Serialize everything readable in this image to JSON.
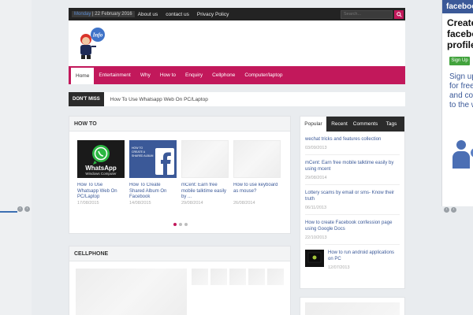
{
  "topbar": {
    "day": "Monday",
    "date": "22 February 2016",
    "links": [
      "About us",
      "contact us",
      "Privacy Policy"
    ],
    "search_placeholder": "Search..."
  },
  "menu": {
    "items": [
      "Home",
      "Entertainment",
      "Why",
      "How to",
      "Enquiry",
      "Cellphone",
      "Computer/laptop"
    ],
    "active": "Home"
  },
  "dont_miss": {
    "label": "DON'T MISS",
    "headline": "How To Use Whatsapp Web On PC/Laptop"
  },
  "howto": {
    "title": "HOW TO",
    "cards": [
      {
        "title": "How To Use Whatsapp Web On PC/Laptop",
        "date": "17/08/2015",
        "thumb": "whatsapp"
      },
      {
        "title": "How To Create Shared Album On Facebook",
        "date": "14/08/2015",
        "thumb": "facebook"
      },
      {
        "title": "mCent: Earn free mobile talktime easily by ...",
        "date": "29/08/2014",
        "thumb": "placeholder"
      },
      {
        "title": "How to use keyboard as mouse?",
        "date": "26/08/2014",
        "thumb": "placeholder"
      }
    ],
    "slide_count": 3,
    "active_slide": 1,
    "whatsapp_text": "WhatsApp",
    "whatsapp_sub": "Windows Computer",
    "fb_text": "HOW TO CREATE A SHARED ALBUM"
  },
  "cellphone": {
    "title": "CELLPHONE"
  },
  "sidebar": {
    "tabs": [
      "Popular",
      "Recent",
      "Comments",
      "Tags"
    ],
    "active_tab": "Popular",
    "posts": [
      {
        "title": "wechat tricks and features collection",
        "date": "03/09/2013"
      },
      {
        "title": "mCent: Earn free mobile talktime easily by using mcent",
        "date": "29/08/2014"
      },
      {
        "title": "Lottery scams by email or sms- Know their truth",
        "date": "06/11/2013"
      },
      {
        "title": "How to create Facebook confession page using Google Docs",
        "date": "22/10/2013"
      },
      {
        "title": "How to run android applications on PC",
        "date": "12/07/2013"
      }
    ]
  },
  "right_ad": {
    "brand": "facebook",
    "title_lines": [
      "Create",
      "facebo",
      "profile"
    ],
    "button": "Sign Up",
    "sub_lines": [
      "Sign up",
      "for free",
      "and conn",
      "to the w"
    ]
  },
  "colors": {
    "accent": "#c2185b",
    "topbar": "#232323",
    "link": "#3b5998",
    "facebook": "#3b5998"
  }
}
